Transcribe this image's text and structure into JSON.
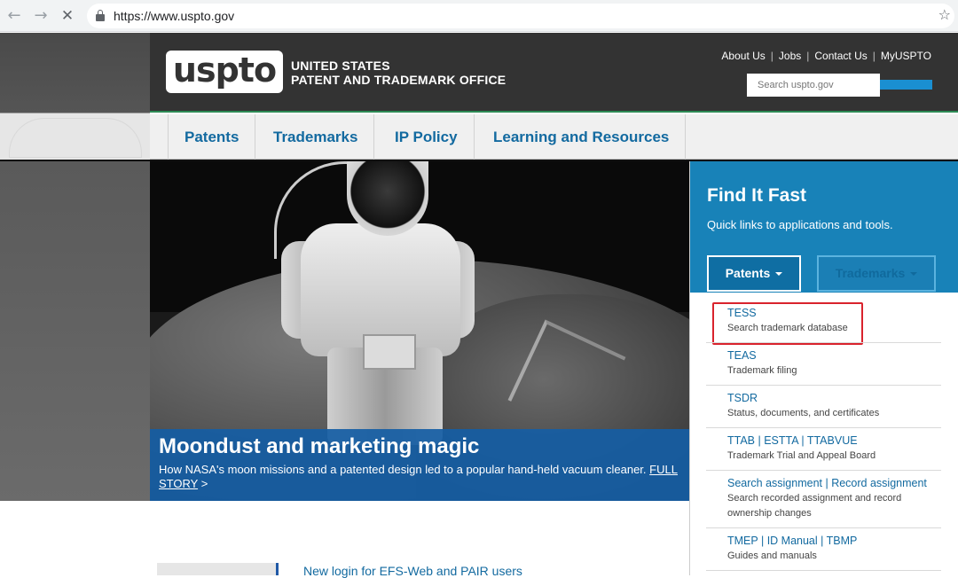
{
  "browser": {
    "url": "https://www.uspto.gov",
    "back_icon": "arrow-left-icon",
    "forward_icon": "arrow-right-icon",
    "stop_icon": "close-icon",
    "lock_icon": "lock-icon",
    "star_icon": "star-icon"
  },
  "header": {
    "logo": "uspto",
    "org_line1": "UNITED STATES",
    "org_line2": "PATENT AND TRADEMARK OFFICE",
    "top_links": [
      "About Us",
      "Jobs",
      "Contact Us",
      "MyUSPTO"
    ],
    "search_placeholder": "Search uspto.gov"
  },
  "nav": {
    "items": [
      "Patents",
      "Trademarks",
      "IP Policy",
      "Learning and Resources"
    ]
  },
  "hero": {
    "title": "Moondust and marketing magic",
    "text": "How NASA's moon missions and a patented design led to a popular hand-held vacuum cleaner.",
    "link": "FULL STORY",
    "link_arrow": ">"
  },
  "find_it_fast": {
    "title": "Find It Fast",
    "subtitle": "Quick links to applications and tools.",
    "tab_patents": "Patents",
    "tab_trademarks": "Trademarks",
    "items": [
      {
        "link": "TESS",
        "desc": "Search trademark database"
      },
      {
        "link": "TEAS",
        "desc": "Trademark filing"
      },
      {
        "link": "TSDR",
        "desc": "Status, documents, and certificates"
      },
      {
        "link": "TTAB | ESTTA | TTABVUE",
        "desc": "Trademark Trial and Appeal Board"
      },
      {
        "link": "Search assignment | Record assignment",
        "desc": "Search recorded assignment and record ownership changes"
      },
      {
        "link": "TMEP | ID Manual | TBMP",
        "desc": "Guides and manuals"
      }
    ]
  },
  "news": {
    "link": "New login for EFS-Web and PAIR users"
  },
  "colors": {
    "header_bg": "#333333",
    "brand_blue": "#1882b8",
    "link_blue": "#136aa0",
    "highlight_red": "#d9232d"
  }
}
